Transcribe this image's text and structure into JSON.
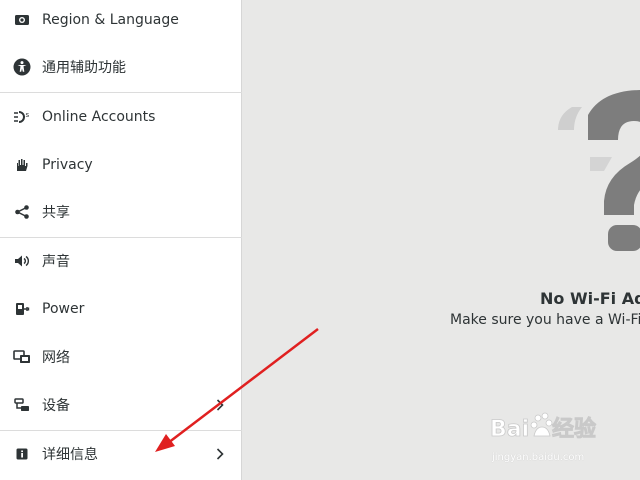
{
  "sidebar": {
    "items": [
      {
        "label": "Region & Language",
        "icon": "region-language-icon",
        "has_chevron": false
      },
      {
        "label": "通用辅助功能",
        "icon": "accessibility-icon",
        "has_chevron": false
      },
      {
        "label": "Online Accounts",
        "icon": "online-accounts-icon",
        "has_chevron": false
      },
      {
        "label": "Privacy",
        "icon": "privacy-hand-icon",
        "has_chevron": false
      },
      {
        "label": "共享",
        "icon": "share-icon",
        "has_chevron": false
      },
      {
        "label": "声音",
        "icon": "speaker-icon",
        "has_chevron": false
      },
      {
        "label": "Power",
        "icon": "power-plug-icon",
        "has_chevron": false
      },
      {
        "label": "网络",
        "icon": "network-icon",
        "has_chevron": false
      },
      {
        "label": "设备",
        "icon": "devices-icon",
        "has_chevron": true
      },
      {
        "label": "详细信息",
        "icon": "info-icon",
        "has_chevron": true
      }
    ]
  },
  "main": {
    "title": "No Wi-Fi Ada",
    "message": "Make sure you have a Wi-Fi ac"
  },
  "watermark": {
    "logo_text": "Bai du 经验",
    "url": "jingyan.baidu.com"
  },
  "colors": {
    "sidebar_bg": "#ffffff",
    "main_bg": "#e8e8e7",
    "icon": "#2e3436",
    "arrow": "#e02020"
  }
}
